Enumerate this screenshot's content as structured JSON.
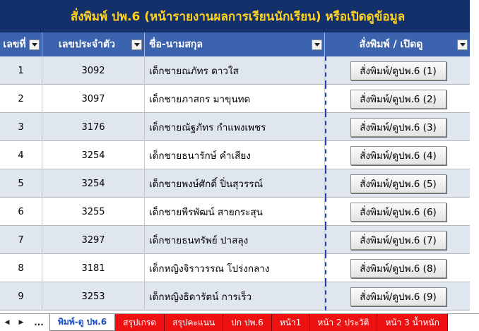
{
  "title": "สั่งพิมพ์ ปพ.6 (หน้ารายงานผลการเรียนนักเรียน) หรือเปิดดูข้อมูล",
  "headers": {
    "no": "เลขที่",
    "student_id": "เลขประจำตัว",
    "name": "ชื่อ-นามสกุล",
    "action": "สั่งพิมพ์ / เปิดดู"
  },
  "rows": [
    {
      "no": "1",
      "student_id": "3092",
      "name": "เด็กชายณภัทร ดาวใส",
      "button": "สั่งพิมพ์/ดูปพ.6 (1)"
    },
    {
      "no": "2",
      "student_id": "3097",
      "name": "เด็กชายภาสกร มาขุนทด",
      "button": "สั่งพิมพ์/ดูปพ.6 (2)"
    },
    {
      "no": "3",
      "student_id": "3176",
      "name": "เด็กชายณัฐภัทร กำแพงเพชร",
      "button": "สั่งพิมพ์/ดูปพ.6 (3)"
    },
    {
      "no": "4",
      "student_id": "3254",
      "name": "เด็กชายธนารักษ์ คำเสียง",
      "button": "สั่งพิมพ์/ดูปพ.6 (4)"
    },
    {
      "no": "5",
      "student_id": "3254",
      "name": "เด็กชายพงษ์ศักดิ์ ปิ่นสุวรรณ์",
      "button": "สั่งพิมพ์/ดูปพ.6 (5)"
    },
    {
      "no": "6",
      "student_id": "3255",
      "name": "เด็กชายพีรพัฒน์ สายกระสุน",
      "button": "สั่งพิมพ์/ดูปพ.6 (6)"
    },
    {
      "no": "7",
      "student_id": "3297",
      "name": "เด็กชายธนทรัพย์ ปาสลุง",
      "button": "สั่งพิมพ์/ดูปพ.6 (7)"
    },
    {
      "no": "8",
      "student_id": "3181",
      "name": "เด็กหญิงจิราวรรณ โปร่งกลาง",
      "button": "สั่งพิมพ์/ดูปพ.6 (8)"
    },
    {
      "no": "9",
      "student_id": "3253",
      "name": "เด็กหญิงธิดารัตน์ การเร็ว",
      "button": "สั่งพิมพ์/ดูปพ.6 (9)"
    }
  ],
  "sheet_nav": {
    "prev": "◀",
    "next": "▶",
    "more": "..."
  },
  "sheet_tabs": [
    "พิมพ์-ดู ปพ.6",
    "สรุปเกรด",
    "สรุปคะแนน",
    "ปก ปพ.6",
    "หน้า1",
    "หน้า 2 ประวัติ",
    "หน้า 3 น้ำหนัก"
  ],
  "active_tab": 0,
  "colors": {
    "title_bg": "#14306b",
    "title_text": "#ffd21f",
    "header_bg": "#3c63ad",
    "row_alt": "#dfe6f0",
    "tab_red": "#ee1111"
  }
}
